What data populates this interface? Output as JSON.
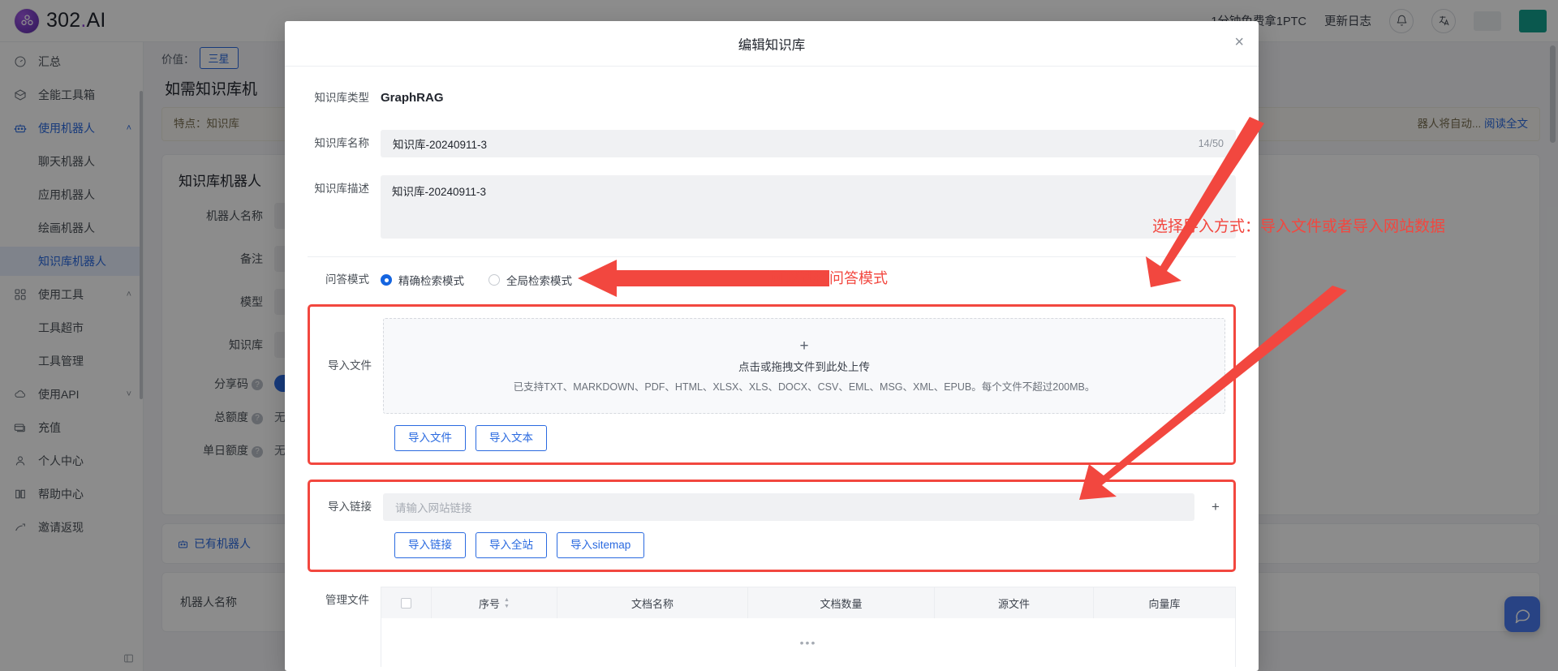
{
  "brand": {
    "name": "302",
    "dot": ".",
    "suffix": "AI"
  },
  "topbar": {
    "promo": "1分钟免费拿1PTC",
    "changelog": "更新日志",
    "bell_icon": "bell-icon",
    "translate_icon": "translate-icon"
  },
  "sidebar": {
    "items": [
      {
        "label": "汇总",
        "icon": "dashboard-icon",
        "type": "item"
      },
      {
        "label": "全能工具箱",
        "icon": "box-icon",
        "type": "item"
      },
      {
        "label": "使用机器人",
        "icon": "robot-icon",
        "type": "parent",
        "expanded": true,
        "caret": "˄"
      },
      {
        "label": "聊天机器人",
        "type": "sub"
      },
      {
        "label": "应用机器人",
        "type": "sub"
      },
      {
        "label": "绘画机器人",
        "type": "sub"
      },
      {
        "label": "知识库机器人",
        "type": "sub",
        "selected": true
      },
      {
        "label": "使用工具",
        "icon": "grid-icon",
        "type": "parent",
        "expanded": true,
        "caret": "˄"
      },
      {
        "label": "工具超市",
        "type": "sub"
      },
      {
        "label": "工具管理",
        "type": "sub"
      },
      {
        "label": "使用API",
        "icon": "cloud-api-icon",
        "type": "parent",
        "expanded": false,
        "caret": "˅"
      },
      {
        "label": "充值",
        "icon": "card-icon",
        "type": "item"
      },
      {
        "label": "个人中心",
        "icon": "user-icon",
        "type": "item"
      },
      {
        "label": "帮助中心",
        "icon": "book-icon",
        "type": "item"
      },
      {
        "label": "邀请返现",
        "icon": "gift-icon",
        "type": "item"
      }
    ],
    "collapse_icon": "collapse-icon"
  },
  "background_page": {
    "breadcrumb_prefix": "价值：",
    "breadcrumb_tab": "三星",
    "section_heading": "如需知识库机",
    "tip_text": "特点：知识库",
    "tip_tail": "器人将自动...",
    "tip_link": "阅读全文",
    "form_title": "知识库机器人",
    "fields": [
      {
        "label": "机器人名称"
      },
      {
        "label": "备注"
      },
      {
        "label": "模型"
      },
      {
        "label": "知识库"
      },
      {
        "label": "分享码",
        "help": "?"
      },
      {
        "label": "总额度",
        "help": "?",
        "value": "无"
      },
      {
        "label": "单日额度",
        "help": "?",
        "value": "无"
      }
    ],
    "existing_bot_chip": "已有机器人",
    "bot_table_header": "机器人名称"
  },
  "modal": {
    "title": "编辑知识库",
    "close_icon": "close-icon",
    "kb_type_label": "知识库类型",
    "kb_type_value": "GraphRAG",
    "kb_name_label": "知识库名称",
    "kb_name_value": "知识库-20240911-3",
    "kb_name_counter": "14/50",
    "kb_desc_label": "知识库描述",
    "kb_desc_value": "知识库-20240911-3",
    "qa_mode_label": "问答模式",
    "qa_modes": [
      {
        "label": "精确检索模式",
        "checked": true
      },
      {
        "label": "全局检索模式",
        "checked": false
      }
    ],
    "import_file_label": "导入文件",
    "drop_plus": "+",
    "drop_main": "点击或拖拽文件到此处上传",
    "drop_sub": "已支持TXT、MARKDOWN、PDF、HTML、XLSX、XLS、DOCX、CSV、EML、MSG、XML、EPUB。每个文件不超过200MB。",
    "file_buttons": [
      "导入文件",
      "导入文本"
    ],
    "import_link_label": "导入链接",
    "link_placeholder": "请输入网站链接",
    "link_add_icon": "plus-icon",
    "link_buttons": [
      "导入链接",
      "导入全站",
      "导入sitemap"
    ],
    "manage_files_label": "管理文件",
    "table_headers": [
      "",
      "序号",
      "文档名称",
      "文档数量",
      "源文件",
      "向量库"
    ],
    "table_loading": "•••"
  },
  "annotations": [
    {
      "id": "anno-import-method",
      "text": "选择导入方式：导入文件或者导入网站数据"
    },
    {
      "id": "anno-qa-mode",
      "text": "可以选择问答模式"
    }
  ],
  "colors": {
    "accent_blue": "#2a6ae0",
    "annotation_red": "#f2473f",
    "brand_purple": "#7a3fc4"
  },
  "fab": {
    "icon": "chat-icon"
  }
}
